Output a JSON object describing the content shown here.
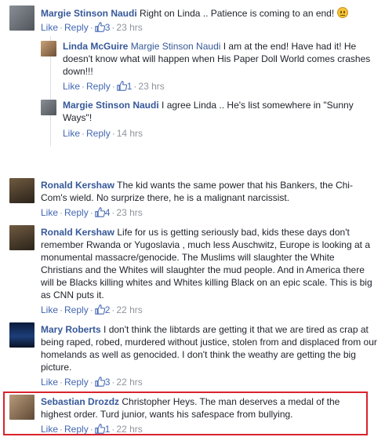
{
  "comments": [
    {
      "name": "Margie Stinson Naudi",
      "text": "Right on Linda .. Patience is coming to an end!",
      "like": "Like",
      "reply": "Reply",
      "likes": "3",
      "time": "23 hrs"
    },
    {
      "name": "Linda McGuire",
      "tag": "Margie Stinson Naudi",
      "text": "I am at the end! Have had it! He doesn't know what will happen when His Paper Doll World comes crashes down!!!",
      "like": "Like",
      "reply": "Reply",
      "likes": "1",
      "time": "23 hrs"
    },
    {
      "name": "Margie Stinson Naudi",
      "text": "I agree Linda .. He's list somewhere in \"Sunny Ways\"!",
      "like": "Like",
      "reply": "Reply",
      "time": "14 hrs"
    },
    {
      "name": "Ronald Kershaw",
      "text": "The kid wants the same power that his Bankers, the Chi-Com's wield. No surprize there, he is a malignant narcissist.",
      "like": "Like",
      "reply": "Reply",
      "likes": "4",
      "time": "23 hrs"
    },
    {
      "name": "Ronald Kershaw",
      "text": "Life for us is getting seriously bad, kids these days don't remember Rwanda or Yugoslavia , much less Auschwitz, Europe is looking at a monumental massacre/genocide. The Muslims will slaughter the White Christians and the Whites will slaughter the mud people. And in America there will be Blacks killing whites and Whites killing Black on an epic scale. This is big as CNN puts it.",
      "like": "Like",
      "reply": "Reply",
      "likes": "2",
      "time": "22 hrs"
    },
    {
      "name": "Mary Roberts",
      "text": "I don't think the libtards are getting it that we are tired as crap at being raped, robed, murdered without justice, stolen from and displaced from our homelands as well as genocided. I don't think the weathy are getting the big picture.",
      "like": "Like",
      "reply": "Reply",
      "likes": "3",
      "time": "22 hrs"
    },
    {
      "name": "Sebastian Drozdz",
      "text": "Christopher Heys. The man deserves a medal of the highest order. Turd junior, wants his safespace from bullying.",
      "like": "Like",
      "reply": "Reply",
      "likes": "1",
      "time": "22 hrs"
    }
  ],
  "colors": {
    "link": "#365899",
    "meta": "#90949c",
    "highlight": "#d9232d"
  },
  "icons": {
    "like": "thumbs-up-icon",
    "emoji": "confused-emoji-icon"
  }
}
